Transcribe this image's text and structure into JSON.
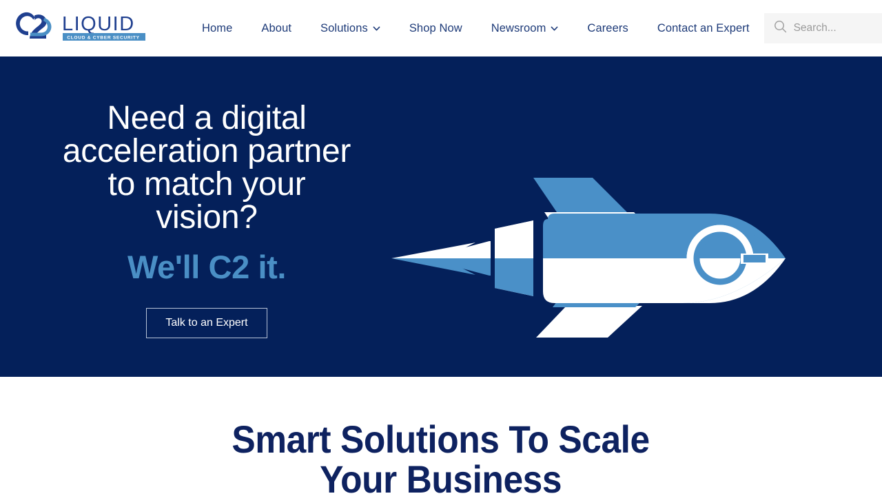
{
  "brand": {
    "mark_text": "C2",
    "name": "LIQUID",
    "tagline": "CLOUD & CYBER SECURITY",
    "logo_dark_blue": "#1f3f8f",
    "logo_light_blue": "#4a8fc5"
  },
  "nav": {
    "items": [
      {
        "label": "Home",
        "has_dropdown": false
      },
      {
        "label": "About",
        "has_dropdown": false
      },
      {
        "label": "Solutions",
        "has_dropdown": true
      },
      {
        "label": "Shop Now",
        "has_dropdown": false
      },
      {
        "label": "Newsroom",
        "has_dropdown": true
      },
      {
        "label": "Careers",
        "has_dropdown": false
      },
      {
        "label": "Contact an Expert",
        "has_dropdown": false
      }
    ]
  },
  "search": {
    "placeholder": "Search...",
    "value": "",
    "icon": "search-icon"
  },
  "hero": {
    "title_line_1": "Need a digital",
    "title_line_2": "acceleration partner",
    "title_line_3": "to match your",
    "title_line_4": "vision?",
    "accent_line": "We'll C2 it.",
    "cta_label": "Talk to an Expert",
    "background_color": "#04205a",
    "accent_color": "#4a8fc5",
    "illustration": "rocket-icon"
  },
  "solutions": {
    "heading_line_1": "Smart Solutions To Scale",
    "heading_line_2": "Your Business",
    "heading_color": "#0e2260"
  }
}
